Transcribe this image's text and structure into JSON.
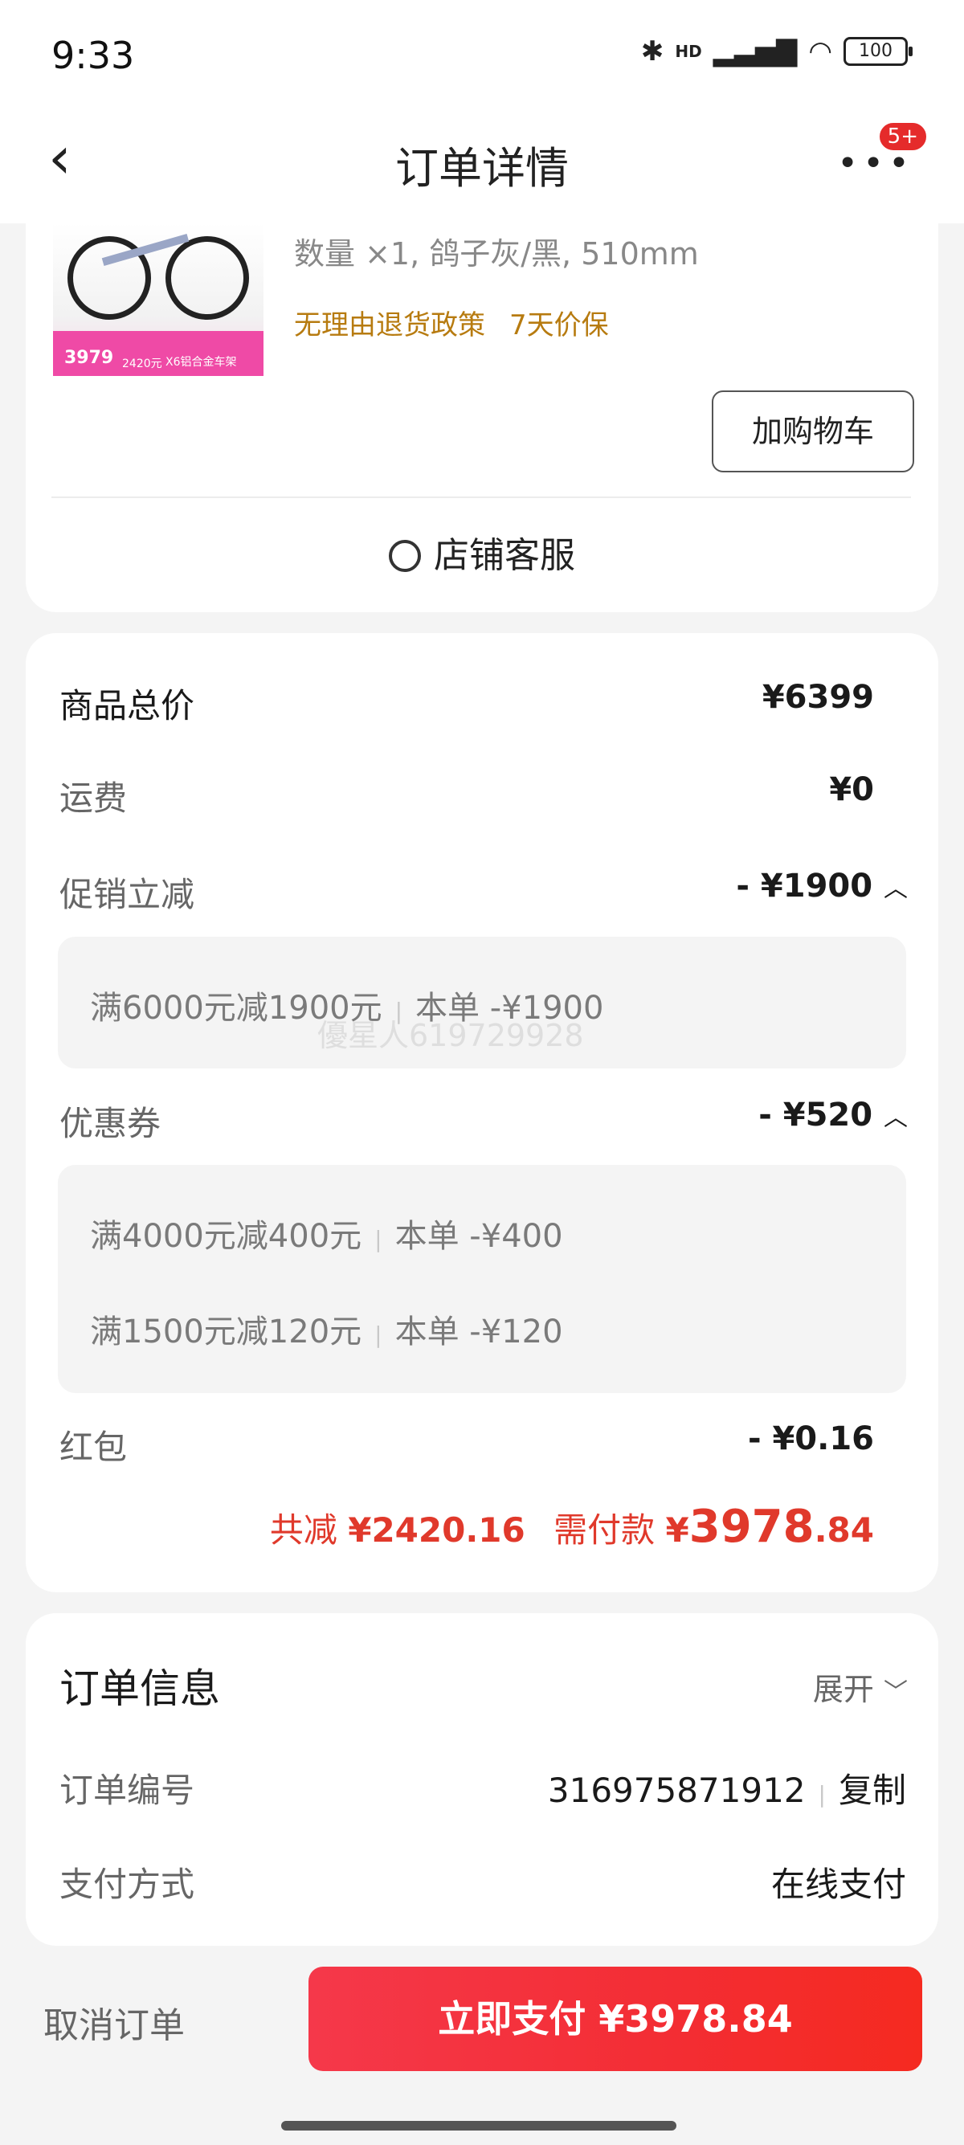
{
  "status_bar": {
    "time": "9:33",
    "network_label": "HD",
    "battery": "100"
  },
  "nav": {
    "title": "订单详情",
    "badge": "5+",
    "more_icon": "more-dots-icon",
    "back_icon": "chevron-left-icon"
  },
  "product": {
    "spec": "数量 ×1, 鸽子灰/黑, 510mm",
    "tags": [
      "无理由退货政策",
      "7天价保"
    ],
    "image_price": "3979",
    "image_price2": "2420元",
    "image_price3": "X6铝合金车架",
    "add_to_cart": "加购物车",
    "service": "店铺客服"
  },
  "price": {
    "total_label": "商品总价",
    "total_value": "¥6399",
    "shipping_label": "运费",
    "shipping_value": "¥0",
    "promo_label": "促销立减",
    "promo_value": "- ¥1900",
    "promo_items": [
      {
        "rule": "满6000元减1900元",
        "this_order": "本单 -¥1900"
      }
    ],
    "coupon_label": "优惠券",
    "coupon_value": "- ¥520",
    "coupon_items": [
      {
        "rule": "满4000元减400元",
        "this_order": "本单 -¥400"
      },
      {
        "rule": "满1500元减120元",
        "this_order": "本单 -¥120"
      }
    ],
    "redpacket_label": "红包",
    "redpacket_value": "- ¥0.16",
    "total_discount_label": "共减",
    "total_discount": "¥2420.16",
    "need_pay_label": "需付款",
    "need_pay_currency": "¥",
    "need_pay_int": "3978",
    "need_pay_dec": ".84",
    "watermark": "優星人619729928"
  },
  "order_info": {
    "title": "订单信息",
    "expand": "展开",
    "order_no_label": "订单编号",
    "order_no": "316975871912",
    "copy": "复制",
    "pay_method_label": "支付方式",
    "pay_method": "在线支付"
  },
  "bottom": {
    "cancel": "取消订单",
    "pay_now": "立即支付 ¥3978.84"
  },
  "colors": {
    "accent_red": "#e0392b",
    "tag_gold": "#b77b10",
    "pay_button": "#f32d33"
  }
}
